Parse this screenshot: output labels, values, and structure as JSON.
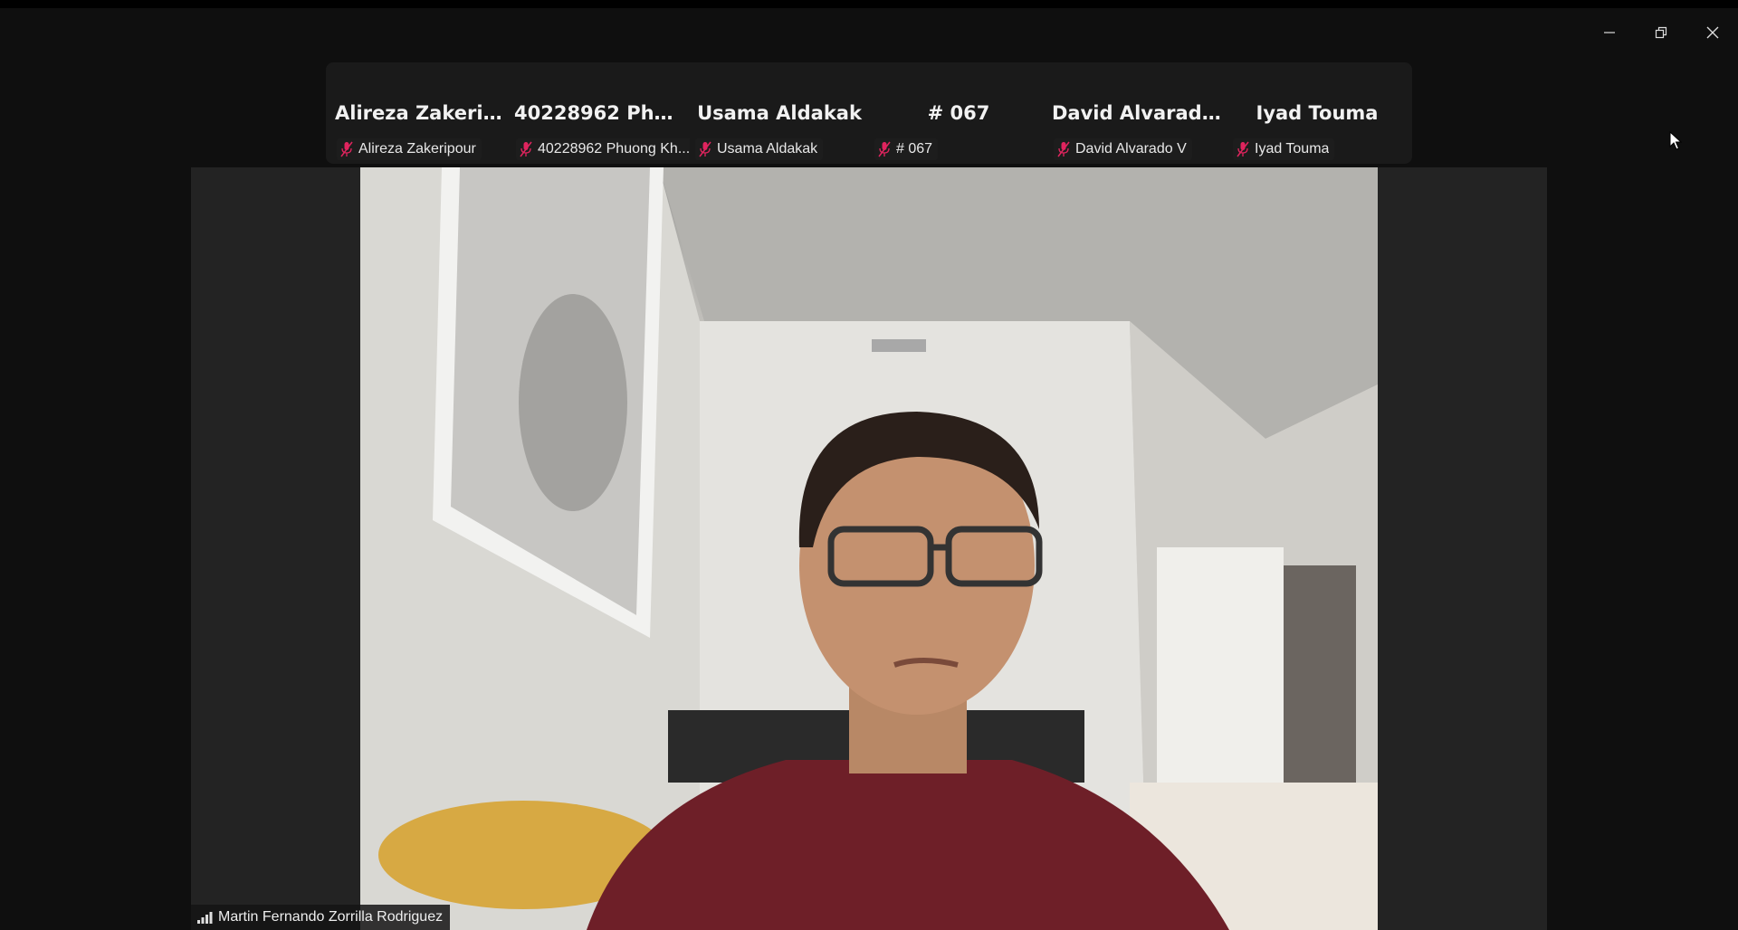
{
  "window": {
    "controls": [
      "minimize-icon",
      "restore-icon",
      "close-icon"
    ]
  },
  "participants_strip": [
    {
      "display": "Alireza  Zakerip...",
      "label": "Alireza Zakeripour",
      "muted": true
    },
    {
      "display": "40228962  Phuo...",
      "label": "40228962 Phuong Kh...",
      "muted": true
    },
    {
      "display": "Usama Aldakak",
      "label": "Usama Aldakak",
      "muted": true
    },
    {
      "display": "# 067",
      "label": "# 067",
      "muted": true
    },
    {
      "display": "David Alvarado V",
      "label": "David Alvarado V",
      "muted": true
    },
    {
      "display": "Iyad Touma",
      "label": "Iyad Touma",
      "muted": true
    }
  ],
  "active_speaker": {
    "name": "Martin Fernando Zorrilla Rodriguez",
    "icon": "signal-bars-icon"
  },
  "colors": {
    "background": "#0f0f0f",
    "strip": "#1a1a1a",
    "stage": "#232323",
    "muted_mic": "#e0245e"
  }
}
